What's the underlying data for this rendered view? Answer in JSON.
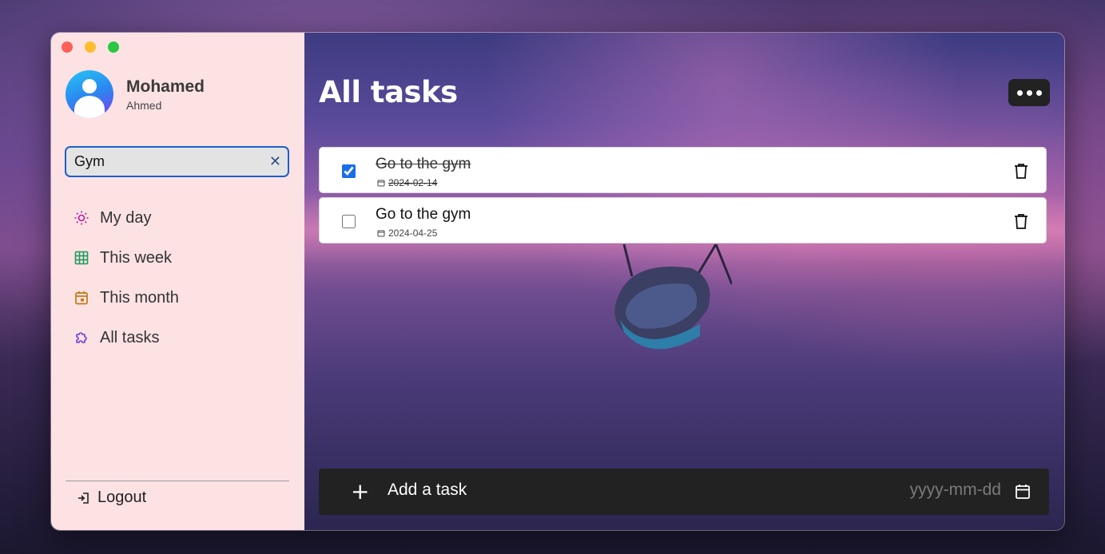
{
  "colors": {
    "accent": "#1d5fc9",
    "sidebar_bg": "#fde2e4",
    "checkbox": "#1a6ee8"
  },
  "profile": {
    "first_name": "Mohamed",
    "last_name": "Ahmed"
  },
  "search": {
    "value": "Gym"
  },
  "nav": [
    {
      "label": "My day",
      "icon": "sun-icon",
      "color": "#c0169b"
    },
    {
      "label": "This week",
      "icon": "grid-icon",
      "color": "#1e9b5e"
    },
    {
      "label": "This month",
      "icon": "calendar-icon",
      "color": "#c07a10"
    },
    {
      "label": "All tasks",
      "icon": "puzzle-icon",
      "color": "#6a3fd8"
    }
  ],
  "logout": {
    "label": "Logout"
  },
  "main": {
    "title": "All tasks"
  },
  "tasks": [
    {
      "title": "Go to the gym",
      "date": "2024-02-14",
      "completed": true
    },
    {
      "title": "Go to the gym",
      "date": "2024-04-25",
      "completed": false
    }
  ],
  "add_task": {
    "placeholder": "Add a task",
    "date_placeholder": "yyyy-mm-dd"
  }
}
